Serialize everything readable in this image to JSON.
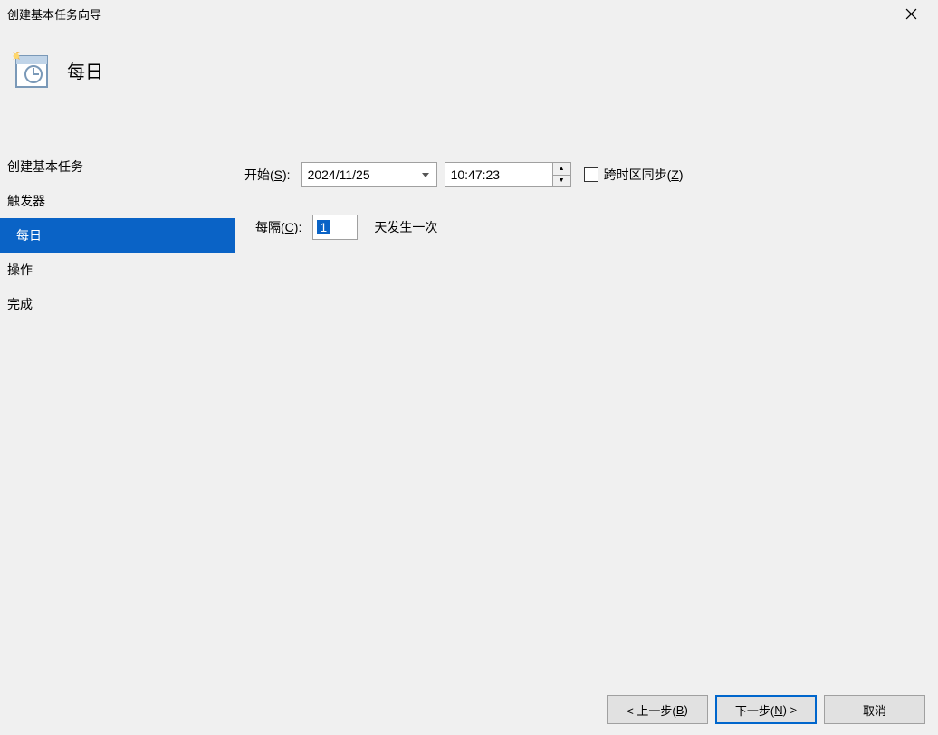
{
  "window": {
    "title": "创建基本任务向导"
  },
  "header": {
    "title": "每日"
  },
  "sidebar": {
    "items": [
      {
        "label": "创建基本任务",
        "selected": false,
        "indent": false
      },
      {
        "label": "触发器",
        "selected": false,
        "indent": false
      },
      {
        "label": "每日",
        "selected": true,
        "indent": true
      },
      {
        "label": "操作",
        "selected": false,
        "indent": false
      },
      {
        "label": "完成",
        "selected": false,
        "indent": false
      }
    ]
  },
  "form": {
    "start_label_prefix": "开始(",
    "start_label_key": "S",
    "start_label_suffix": "):",
    "date_value": "2024/11/25",
    "time_value": "10:47:23",
    "sync_label_prefix": "跨时区同步(",
    "sync_label_key": "Z",
    "sync_label_suffix": ")",
    "interval_label_prefix": "每隔(",
    "interval_label_key": "C",
    "interval_label_suffix": "):",
    "interval_value": "1",
    "interval_unit": "天发生一次"
  },
  "footer": {
    "back_prefix": "< 上一步(",
    "back_key": "B",
    "back_suffix": ")",
    "next_prefix": "下一步(",
    "next_key": "N",
    "next_suffix": ") >",
    "cancel": "取消"
  }
}
